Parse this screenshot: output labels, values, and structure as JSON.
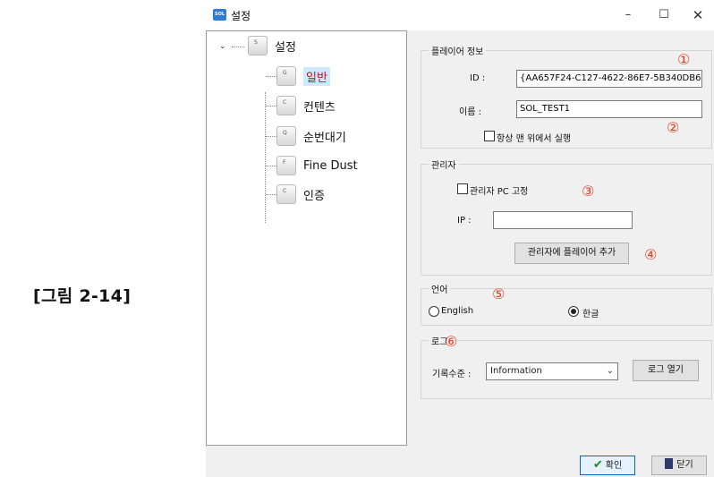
{
  "figure_caption": "[그림 2-14]",
  "window": {
    "title": "설정",
    "app_icon_text": "SOL",
    "min_glyph": "–",
    "max_glyph": "☐",
    "close_glyph": "✕"
  },
  "tree": {
    "root": {
      "label": "설정",
      "key": "S"
    },
    "items": [
      {
        "label": "일반",
        "key": "G",
        "selected": true
      },
      {
        "label": "컨텐츠",
        "key": "C"
      },
      {
        "label": "순번대기",
        "key": "Q"
      },
      {
        "label": "Fine Dust",
        "key": "F"
      },
      {
        "label": "인증",
        "key": "C"
      }
    ]
  },
  "player_info": {
    "group_title": "플레이어 정보",
    "id_label": "ID :",
    "id_value": "{AA657F24-C127-4622-86E7-5B340DB6",
    "name_label": "이름 :",
    "name_value": "SOL_TEST1",
    "always_on_top_label": "항상 맨 위에서 실행",
    "always_on_top_checked": false
  },
  "admin": {
    "group_title": "관리자",
    "fix_pc_label": "관리자 PC 고정",
    "fix_pc_checked": false,
    "ip_label": "IP :",
    "ip_value": "",
    "add_button": "관리자에 플레이어 추가"
  },
  "language": {
    "group_title": "언어",
    "options": [
      "English",
      "한글"
    ],
    "selected": "한글"
  },
  "log": {
    "group_title": "로그",
    "level_label": "기록수준 :",
    "level_value": "Information",
    "open_button": "로그 열기"
  },
  "footer": {
    "ok_label": "확인",
    "close_label": "닫기"
  },
  "annotations": [
    "①",
    "②",
    "③",
    "④",
    "⑤",
    "⑥"
  ],
  "colors": {
    "annotation": "#e53e1f",
    "selected_text": "#c0121f",
    "selected_bg": "#cde8ff",
    "ok_border": "#0a64c8"
  }
}
